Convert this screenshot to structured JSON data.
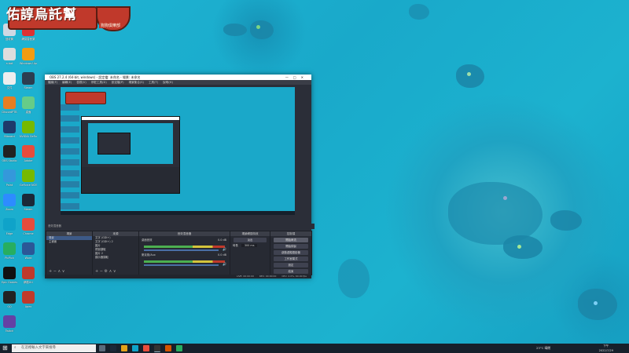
{
  "banner": {
    "title": "佑諄烏託幫",
    "subtitle": "狗狗俱樂部"
  },
  "desktop_icons": [
    {
      "label": "回收筒",
      "color": "#cfd8e3"
    },
    {
      "label": "網易雲音樂",
      "color": "#d33"
    },
    {
      "label": "a.bat",
      "color": "#ddd"
    },
    {
      "label": "Windows Update",
      "color": "#f39c12"
    },
    {
      "label": "文件",
      "color": "#eee"
    },
    {
      "label": "Steam",
      "color": "#2c3e50"
    },
    {
      "label": "DiscordPTB",
      "color": "#e67e22"
    },
    {
      "label": "桌面",
      "color": "#6c8"
    },
    {
      "label": "Blizzard",
      "color": "#1e3a6b"
    },
    {
      "label": "NVIDIA GeForce",
      "color": "#76b900"
    },
    {
      "label": "OBS Studio",
      "color": "#222"
    },
    {
      "label": "Adobe",
      "color": "#e74c3c"
    },
    {
      "label": "Paint",
      "color": "#3498db"
    },
    {
      "label": "GeForce NOW",
      "color": "#76b900"
    },
    {
      "label": "Zoom",
      "color": "#2d8cff"
    },
    {
      "label": "Steam",
      "color": "#1b2838"
    },
    {
      "label": "Edge",
      "color": "#0fa3c9"
    },
    {
      "label": "Chrome",
      "color": "#e74c3c"
    },
    {
      "label": "PicPick",
      "color": "#27ae60"
    },
    {
      "label": "Word",
      "color": "#2b5797"
    },
    {
      "label": "Epic Games",
      "color": "#111"
    },
    {
      "label": "網易UU",
      "color": "#c0392b"
    },
    {
      "label": "QQ",
      "color": "#222"
    },
    {
      "label": "Apex",
      "color": "#c0392b"
    },
    {
      "label": "Twitch",
      "color": "#6441a4"
    }
  ],
  "obs": {
    "window_title": "OBS 27.2.4 (64-bit, windows) - 設定檔: 未命名 - 場景: 未命名",
    "menu": [
      "檔案(F)",
      "編輯(E)",
      "檢視(V)",
      "停駐工具(D)",
      "設定檔(P)",
      "場景集合(S)",
      "工具(T)",
      "說明(H)"
    ],
    "docks": {
      "scenes": {
        "header": "場景",
        "items": [
          "場景",
          "主畫面"
        ]
      },
      "sources": {
        "header": "來源",
        "items": [
          "文字 (GDI+)",
          "文字 (GDI+) 2",
          "圖片",
          "視窗擷取",
          "圖片 2",
          "顯示器擷取"
        ]
      },
      "mixer": {
        "header": "音效混音器",
        "channels": [
          {
            "name": "桌面音效",
            "level": "0.0 dB"
          },
          {
            "name": "麥克風/Aux",
            "level": "0.0 dB"
          }
        ]
      },
      "transitions": {
        "header": "場景轉換特效",
        "type": "淡出",
        "duration_label": "時長",
        "duration": "300 ms"
      },
      "controls": {
        "header": "控制項",
        "buttons": [
          "開始串流",
          "開始錄製",
          "啟動虛擬攝影機",
          "工作室模式",
          "設定",
          "結束"
        ]
      }
    },
    "status": {
      "live": "LIVE: 00:00:00",
      "rec": "REC: 00:00:00",
      "cpu": "CPU: 2.0%, 60.00 fps"
    }
  },
  "taskbar": {
    "search_placeholder": "在這裡輸入文字來搜尋",
    "weather": "23°C 晴朗",
    "time": "下午",
    "date": "2022/7/29"
  }
}
